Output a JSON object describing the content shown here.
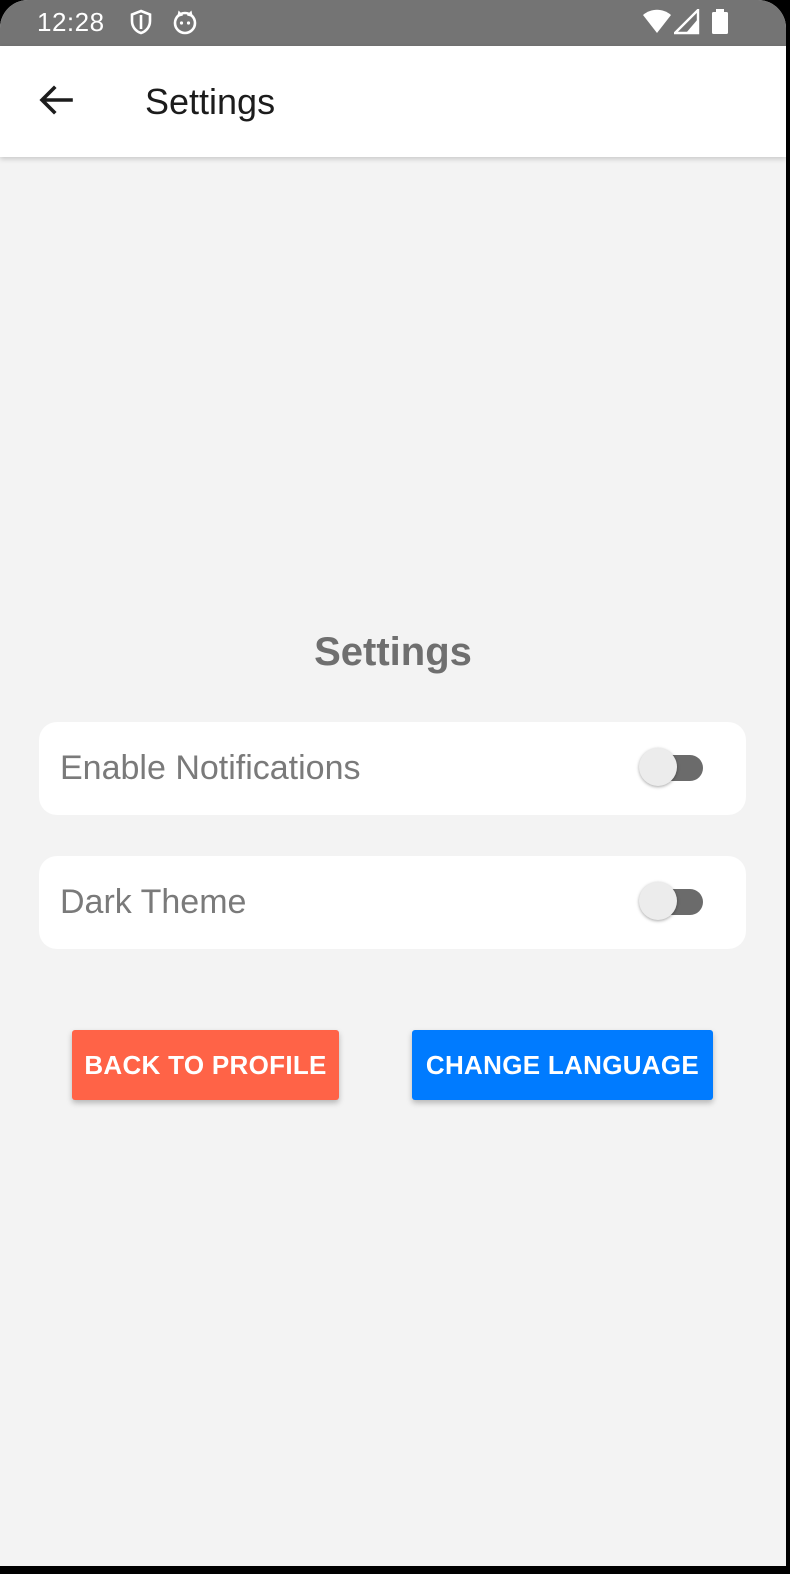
{
  "status_bar": {
    "time": "12:28",
    "left_icons": [
      "shield-icon",
      "cat-icon"
    ],
    "right_icons": [
      "wifi-icon",
      "signal-icon",
      "battery-icon"
    ],
    "background": "#747474"
  },
  "app_bar": {
    "back_icon": "arrow-back-icon",
    "title": "Settings"
  },
  "main": {
    "heading": "Settings",
    "settings": [
      {
        "label": "Enable Notifications",
        "enabled": false
      },
      {
        "label": "Dark Theme",
        "enabled": false
      }
    ],
    "buttons": {
      "back_to_profile": {
        "label": "BACK TO PROFILE",
        "color": "#ff6347"
      },
      "change_language": {
        "label": "CHANGE LANGUAGE",
        "color": "#007bff"
      }
    }
  }
}
